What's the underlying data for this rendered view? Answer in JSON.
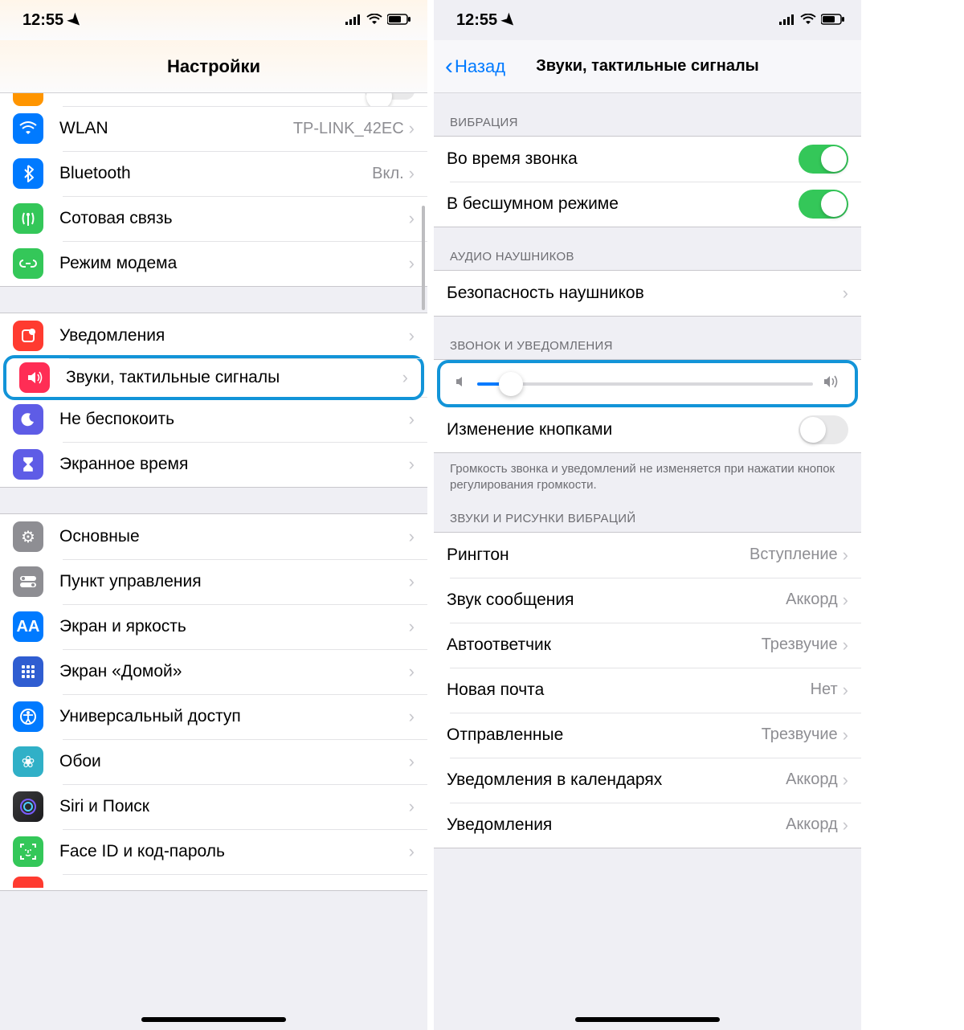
{
  "status": {
    "time": "12:55"
  },
  "left": {
    "title": "Настройки",
    "rows": [
      {
        "icon": "wifi",
        "label": "WLAN",
        "detail": "TP-LINK_42EC",
        "bg": "bg-blue"
      },
      {
        "icon": "bt",
        "label": "Bluetooth",
        "detail": "Вкл.",
        "bg": "bg-blue"
      },
      {
        "icon": "cell",
        "label": "Сотовая связь",
        "detail": "",
        "bg": "bg-green"
      },
      {
        "icon": "hotspot",
        "label": "Режим модема",
        "detail": "",
        "bg": "bg-green"
      }
    ],
    "rows2": [
      {
        "icon": "notif",
        "label": "Уведомления",
        "bg": "bg-red"
      },
      {
        "icon": "sound",
        "label": "Звуки, тактильные сигналы",
        "bg": "bg-pink",
        "highlight": true
      },
      {
        "icon": "moon",
        "label": "Не беспокоить",
        "bg": "bg-lilac"
      },
      {
        "icon": "hourglass",
        "label": "Экранное время",
        "bg": "bg-lilac"
      }
    ],
    "rows3": [
      {
        "icon": "gear",
        "label": "Основные",
        "bg": "bg-gray"
      },
      {
        "icon": "cc",
        "label": "Пункт управления",
        "bg": "bg-gray"
      },
      {
        "icon": "aa",
        "label": "Экран и яркость",
        "bg": "bg-ltblue"
      },
      {
        "icon": "home",
        "label": "Экран «Домой»",
        "bg": "bg-homesc"
      },
      {
        "icon": "access",
        "label": "Универсальный доступ",
        "bg": "bg-ltblue"
      },
      {
        "icon": "wall",
        "label": "Обои",
        "bg": "bg-linen"
      },
      {
        "icon": "siri",
        "label": "Siri и Поиск",
        "bg": "bg-siri"
      },
      {
        "icon": "faceid",
        "label": "Face ID и код-пароль",
        "bg": "bg-faceid"
      }
    ]
  },
  "right": {
    "back": "Назад",
    "title": "Звуки, тактильные сигналы",
    "sections": {
      "vibration": {
        "header": "ВИБРАЦИЯ",
        "row1": "Во время звонка",
        "row2": "В бесшумном режиме"
      },
      "headphone": {
        "header": "АУДИО НАУШНИКОВ",
        "row": "Безопасность наушников"
      },
      "ringer": {
        "header": "ЗВОНОК И УВЕДОМЛЕНИЯ",
        "slider_value": 10,
        "change_row": "Изменение кнопками",
        "footer": "Громкость звонка и уведомлений не изменяется при нажатии кнопок регулирования громкости."
      },
      "sounds": {
        "header": "ЗВУКИ И РИСУНКИ ВИБРАЦИЙ",
        "rows": [
          {
            "label": "Рингтон",
            "detail": "Вступление"
          },
          {
            "label": "Звук сообщения",
            "detail": "Аккорд"
          },
          {
            "label": "Автоответчик",
            "detail": "Трезвучие"
          },
          {
            "label": "Новая почта",
            "detail": "Нет"
          },
          {
            "label": "Отправленные",
            "detail": "Трезвучие"
          },
          {
            "label": "Уведомления в календарях",
            "detail": "Аккорд"
          },
          {
            "label": "Уведомления",
            "detail": "Аккорд"
          }
        ]
      }
    }
  }
}
